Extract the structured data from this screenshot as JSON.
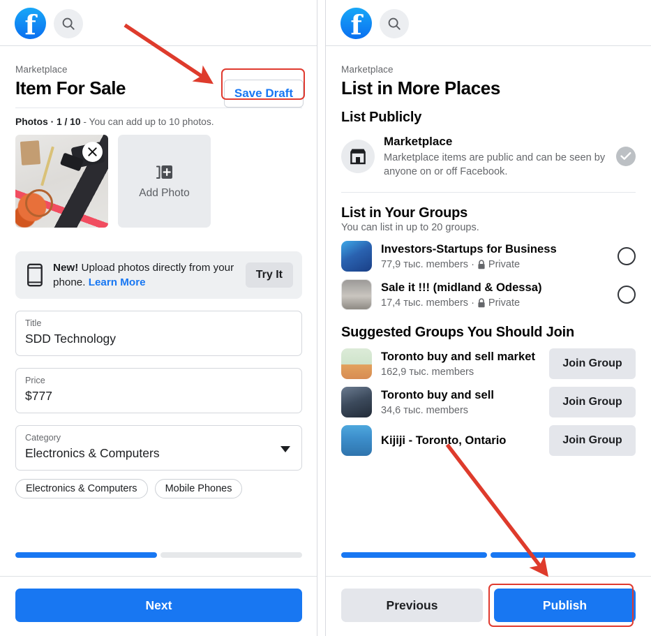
{
  "left": {
    "topbar": {
      "logo": "facebook-logo",
      "search": "search-icon"
    },
    "eyebrow": "Marketplace",
    "title": "Item For Sale",
    "save_draft": "Save Draft",
    "photos_prefix": "Photos · 1 / 10",
    "photos_suffix": " - You can add up to 10 photos.",
    "add_photo": "Add Photo",
    "remove_photo": "close-icon",
    "banner": {
      "bold": "New!",
      "text": " Upload photos directly from your phone. ",
      "link": "Learn More",
      "button": "Try It"
    },
    "fields": [
      {
        "label": "Title",
        "value": "SDD Technology"
      },
      {
        "label": "Price",
        "value": "$777"
      },
      {
        "label": "Category",
        "value": "Electronics & Computers"
      }
    ],
    "chips": [
      "Electronics & Computers",
      "Mobile Phones"
    ],
    "progress": {
      "segments": [
        "on",
        "off"
      ]
    },
    "next": "Next"
  },
  "right": {
    "topbar": {
      "logo": "facebook-logo",
      "search": "search-icon"
    },
    "eyebrow": "Marketplace",
    "title": "List in More Places",
    "list_publicly": {
      "heading": "List Publicly",
      "item_title": "Marketplace",
      "item_desc": "Marketplace items are public and can be seen by anyone on or off Facebook.",
      "state": "selected"
    },
    "your_groups": {
      "heading": "List in Your Groups",
      "sub": "You can list in up to 20 groups.",
      "items": [
        {
          "name": "Investors-Startups for Business",
          "members": "77,9 тыс. members",
          "sep": "·",
          "privacy": "Private"
        },
        {
          "name": "Sale it !!! (midland & Odessa)",
          "members": "17,4 тыс. members",
          "sep": "·",
          "privacy": "Private"
        }
      ]
    },
    "suggested": {
      "heading": "Suggested Groups You Should Join",
      "items": [
        {
          "name": "Toronto buy and sell market",
          "members": "162,9 тыс. members",
          "action": "Join Group"
        },
        {
          "name": "Toronto buy and sell",
          "members": "34,6 тыс. members",
          "action": "Join Group"
        },
        {
          "name": "Kijiji - Toronto, Ontario",
          "members": "",
          "action": "Join Group"
        }
      ]
    },
    "progress": {
      "segments": [
        "on",
        "on"
      ]
    },
    "previous": "Previous",
    "publish": "Publish"
  },
  "annotations": {
    "arrow_color": "#de3b2c",
    "highlight_color": "#e03a2f",
    "arrows": [
      "arrow-to-save-draft",
      "arrow-to-publish"
    ],
    "highlights": [
      "save-draft-highlight",
      "publish-highlight"
    ]
  },
  "colors": {
    "brand_blue": "#1877f2",
    "link_blue": "#1877f2",
    "text_primary": "#050505",
    "text_secondary": "#65676b",
    "surface_gray": "#e4e6eb",
    "accent_red": "#e03a2f"
  }
}
